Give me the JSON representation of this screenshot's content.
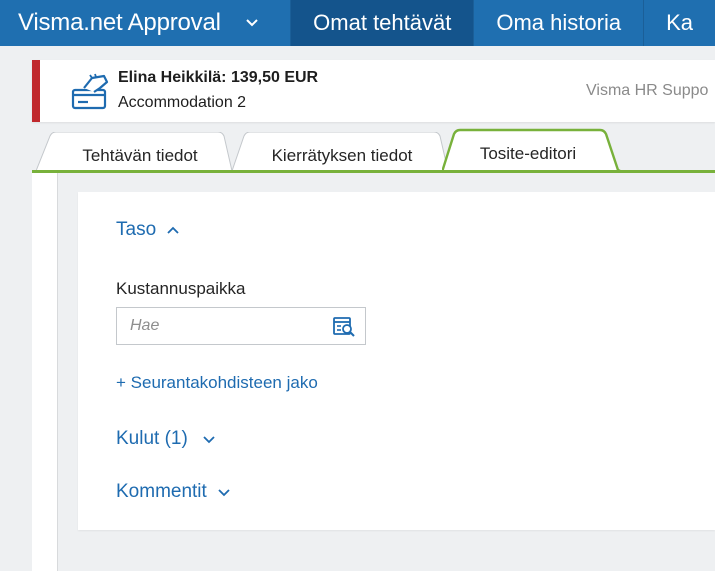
{
  "nav": {
    "brand": "Visma.net Approval",
    "items": [
      {
        "label": "Omat tehtävät",
        "active": true
      },
      {
        "label": "Oma historia",
        "active": false
      },
      {
        "label": "Ka",
        "active": false
      }
    ]
  },
  "task": {
    "title": "Elina Heikkilä: 139,50 EUR",
    "subtitle": "Accommodation 2",
    "company": "Visma HR Suppo",
    "icon": "card-payment-icon",
    "status_color": "#c0282d"
  },
  "tabs": [
    {
      "label": "Tehtävän tiedot",
      "active": false
    },
    {
      "label": "Kierrätyksen tiedot",
      "active": false
    },
    {
      "label": "Tosite-editori",
      "active": true
    }
  ],
  "editor": {
    "level_section": "Taso",
    "cost_center_label": "Kustannuspaikka",
    "cost_center_placeholder": "Hae",
    "cost_center_value": "",
    "tracking_link": "+ Seurantakohdisteen jako",
    "expenses_section": "Kulut (1)",
    "comments_section": "Kommentit"
  },
  "colors": {
    "nav_bg": "#1f6fb0",
    "nav_active": "#14548c",
    "accent_blue": "#1e6bb0",
    "tab_accent": "#78b13b"
  }
}
